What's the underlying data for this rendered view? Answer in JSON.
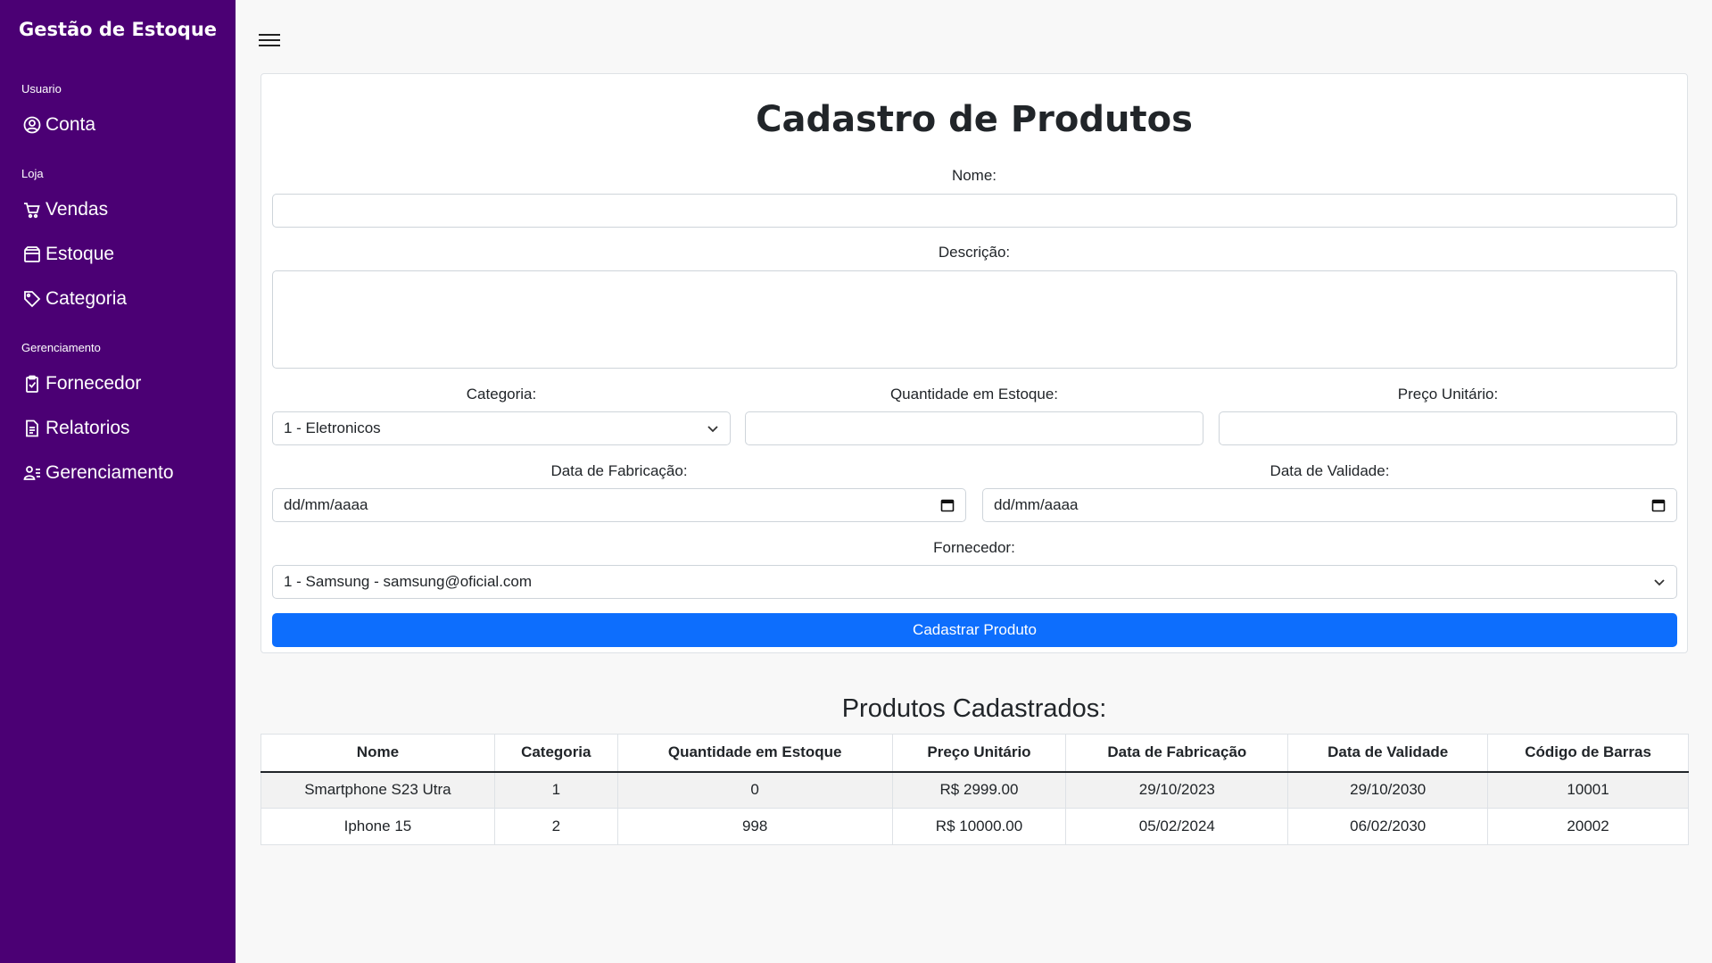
{
  "app": {
    "title": "Gestão de Estoque"
  },
  "sidebar": {
    "sections": [
      {
        "label": "Usuario",
        "items": [
          {
            "label": "Conta",
            "icon": "user-circle-icon"
          }
        ]
      },
      {
        "label": "Loja",
        "items": [
          {
            "label": "Vendas",
            "icon": "cart-icon"
          },
          {
            "label": "Estoque",
            "icon": "box-icon"
          },
          {
            "label": "Categoria",
            "icon": "tag-icon"
          }
        ]
      },
      {
        "label": "Gerenciamento",
        "items": [
          {
            "label": "Fornecedor",
            "icon": "clipboard-check-icon"
          },
          {
            "label": "Relatorios",
            "icon": "document-icon"
          },
          {
            "label": "Gerenciamento",
            "icon": "user-list-icon"
          }
        ]
      }
    ]
  },
  "form": {
    "title": "Cadastro de Produtos",
    "nome_label": "Nome:",
    "nome_value": "",
    "descricao_label": "Descrição:",
    "descricao_value": "",
    "categoria_label": "Categoria:",
    "categoria_value": "1 - Eletronicos",
    "quantidade_label": "Quantidade em Estoque:",
    "quantidade_value": "",
    "preco_label": "Preço Unitário:",
    "preco_value": "",
    "fabricacao_label": "Data de Fabricação:",
    "fabricacao_placeholder": "dd/mm/aaaa",
    "validade_label": "Data de Validade:",
    "validade_placeholder": "dd/mm/aaaa",
    "fornecedor_label": "Fornecedor:",
    "fornecedor_value": "1 - Samsung - samsung@oficial.com",
    "submit_label": "Cadastrar Produto"
  },
  "products": {
    "title": "Produtos Cadastrados:",
    "columns": [
      "Nome",
      "Categoria",
      "Quantidade em Estoque",
      "Preço Unitário",
      "Data de Fabricação",
      "Data de Validade",
      "Código de Barras"
    ],
    "rows": [
      [
        "Smartphone S23 Utra",
        "1",
        "0",
        "R$ 2999.00",
        "29/10/2023",
        "29/10/2030",
        "10001"
      ],
      [
        "Iphone 15",
        "2",
        "998",
        "R$ 10000.00",
        "05/02/2024",
        "06/02/2030",
        "20002"
      ]
    ]
  },
  "colors": {
    "sidebar": "#4b0074",
    "primary": "#0d6efd",
    "background": "#f8f8f8"
  }
}
